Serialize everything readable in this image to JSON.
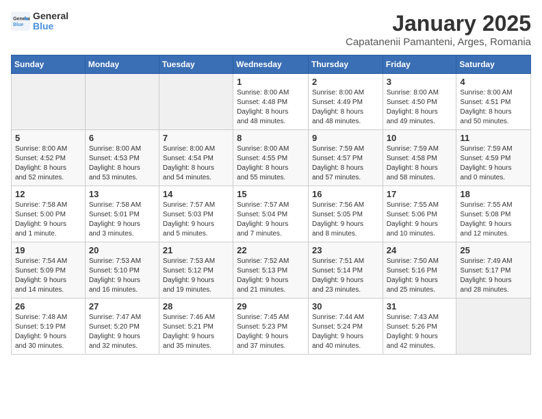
{
  "logo": {
    "line1": "General",
    "line2": "Blue"
  },
  "title": "January 2025",
  "subtitle": "Capatanenii Pamanteni, Arges, Romania",
  "weekdays": [
    "Sunday",
    "Monday",
    "Tuesday",
    "Wednesday",
    "Thursday",
    "Friday",
    "Saturday"
  ],
  "weeks": [
    [
      {
        "day": "",
        "info": ""
      },
      {
        "day": "",
        "info": ""
      },
      {
        "day": "",
        "info": ""
      },
      {
        "day": "1",
        "info": "Sunrise: 8:00 AM\nSunset: 4:48 PM\nDaylight: 8 hours\nand 48 minutes."
      },
      {
        "day": "2",
        "info": "Sunrise: 8:00 AM\nSunset: 4:49 PM\nDaylight: 8 hours\nand 48 minutes."
      },
      {
        "day": "3",
        "info": "Sunrise: 8:00 AM\nSunset: 4:50 PM\nDaylight: 8 hours\nand 49 minutes."
      },
      {
        "day": "4",
        "info": "Sunrise: 8:00 AM\nSunset: 4:51 PM\nDaylight: 8 hours\nand 50 minutes."
      }
    ],
    [
      {
        "day": "5",
        "info": "Sunrise: 8:00 AM\nSunset: 4:52 PM\nDaylight: 8 hours\nand 52 minutes."
      },
      {
        "day": "6",
        "info": "Sunrise: 8:00 AM\nSunset: 4:53 PM\nDaylight: 8 hours\nand 53 minutes."
      },
      {
        "day": "7",
        "info": "Sunrise: 8:00 AM\nSunset: 4:54 PM\nDaylight: 8 hours\nand 54 minutes."
      },
      {
        "day": "8",
        "info": "Sunrise: 8:00 AM\nSunset: 4:55 PM\nDaylight: 8 hours\nand 55 minutes."
      },
      {
        "day": "9",
        "info": "Sunrise: 7:59 AM\nSunset: 4:57 PM\nDaylight: 8 hours\nand 57 minutes."
      },
      {
        "day": "10",
        "info": "Sunrise: 7:59 AM\nSunset: 4:58 PM\nDaylight: 8 hours\nand 58 minutes."
      },
      {
        "day": "11",
        "info": "Sunrise: 7:59 AM\nSunset: 4:59 PM\nDaylight: 9 hours\nand 0 minutes."
      }
    ],
    [
      {
        "day": "12",
        "info": "Sunrise: 7:58 AM\nSunset: 5:00 PM\nDaylight: 9 hours\nand 1 minute."
      },
      {
        "day": "13",
        "info": "Sunrise: 7:58 AM\nSunset: 5:01 PM\nDaylight: 9 hours\nand 3 minutes."
      },
      {
        "day": "14",
        "info": "Sunrise: 7:57 AM\nSunset: 5:03 PM\nDaylight: 9 hours\nand 5 minutes."
      },
      {
        "day": "15",
        "info": "Sunrise: 7:57 AM\nSunset: 5:04 PM\nDaylight: 9 hours\nand 7 minutes."
      },
      {
        "day": "16",
        "info": "Sunrise: 7:56 AM\nSunset: 5:05 PM\nDaylight: 9 hours\nand 8 minutes."
      },
      {
        "day": "17",
        "info": "Sunrise: 7:55 AM\nSunset: 5:06 PM\nDaylight: 9 hours\nand 10 minutes."
      },
      {
        "day": "18",
        "info": "Sunrise: 7:55 AM\nSunset: 5:08 PM\nDaylight: 9 hours\nand 12 minutes."
      }
    ],
    [
      {
        "day": "19",
        "info": "Sunrise: 7:54 AM\nSunset: 5:09 PM\nDaylight: 9 hours\nand 14 minutes."
      },
      {
        "day": "20",
        "info": "Sunrise: 7:53 AM\nSunset: 5:10 PM\nDaylight: 9 hours\nand 16 minutes."
      },
      {
        "day": "21",
        "info": "Sunrise: 7:53 AM\nSunset: 5:12 PM\nDaylight: 9 hours\nand 19 minutes."
      },
      {
        "day": "22",
        "info": "Sunrise: 7:52 AM\nSunset: 5:13 PM\nDaylight: 9 hours\nand 21 minutes."
      },
      {
        "day": "23",
        "info": "Sunrise: 7:51 AM\nSunset: 5:14 PM\nDaylight: 9 hours\nand 23 minutes."
      },
      {
        "day": "24",
        "info": "Sunrise: 7:50 AM\nSunset: 5:16 PM\nDaylight: 9 hours\nand 25 minutes."
      },
      {
        "day": "25",
        "info": "Sunrise: 7:49 AM\nSunset: 5:17 PM\nDaylight: 9 hours\nand 28 minutes."
      }
    ],
    [
      {
        "day": "26",
        "info": "Sunrise: 7:48 AM\nSunset: 5:19 PM\nDaylight: 9 hours\nand 30 minutes."
      },
      {
        "day": "27",
        "info": "Sunrise: 7:47 AM\nSunset: 5:20 PM\nDaylight: 9 hours\nand 32 minutes."
      },
      {
        "day": "28",
        "info": "Sunrise: 7:46 AM\nSunset: 5:21 PM\nDaylight: 9 hours\nand 35 minutes."
      },
      {
        "day": "29",
        "info": "Sunrise: 7:45 AM\nSunset: 5:23 PM\nDaylight: 9 hours\nand 37 minutes."
      },
      {
        "day": "30",
        "info": "Sunrise: 7:44 AM\nSunset: 5:24 PM\nDaylight: 9 hours\nand 40 minutes."
      },
      {
        "day": "31",
        "info": "Sunrise: 7:43 AM\nSunset: 5:26 PM\nDaylight: 9 hours\nand 42 minutes."
      },
      {
        "day": "",
        "info": ""
      }
    ]
  ]
}
